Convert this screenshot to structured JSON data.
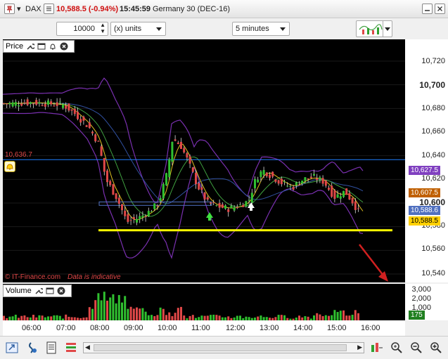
{
  "titlebar": {
    "symbol": "DAX",
    "price_change": "10,588.5 (-0.94%)",
    "time": "15:45:59",
    "instrument": "Germany 30 (DEC-16)"
  },
  "toolbar": {
    "quantity": "10000",
    "units": "(x) units",
    "timeframe": "5 minutes"
  },
  "price_panel": {
    "label": "Price",
    "y_ticks": [
      "10,720",
      "10,700",
      "10,680",
      "10,660",
      "10,640",
      "10,620",
      "10,600",
      "10,580",
      "10,560",
      "10,540"
    ],
    "alert_level": "10,636.7",
    "tags": [
      {
        "text": "10,627.5",
        "color": "#8040c0"
      },
      {
        "text": "10,607.5",
        "color": "#c06000"
      },
      {
        "text": "10,588.6",
        "color": "#5070c0"
      },
      {
        "text": "10,588.5",
        "color": "#ffd000"
      }
    ],
    "watermark": "© IT-Finance.com",
    "disclaimer": "Data is indicative"
  },
  "volume_panel": {
    "label": "Volume",
    "y_ticks": [
      "3,000",
      "2,000",
      "1,000"
    ],
    "last_value": "175"
  },
  "x_ticks": [
    "06:00",
    "07:00",
    "08:00",
    "09:00",
    "10:00",
    "11:00",
    "12:00",
    "13:00",
    "14:00",
    "15:00",
    "16:00"
  ],
  "colors": {
    "up_candle": "#30c030",
    "down_candle": "#e04848",
    "support_line": "#ffff00",
    "alert_line": "#2080ff",
    "bollinger": "#7a30b0"
  }
}
